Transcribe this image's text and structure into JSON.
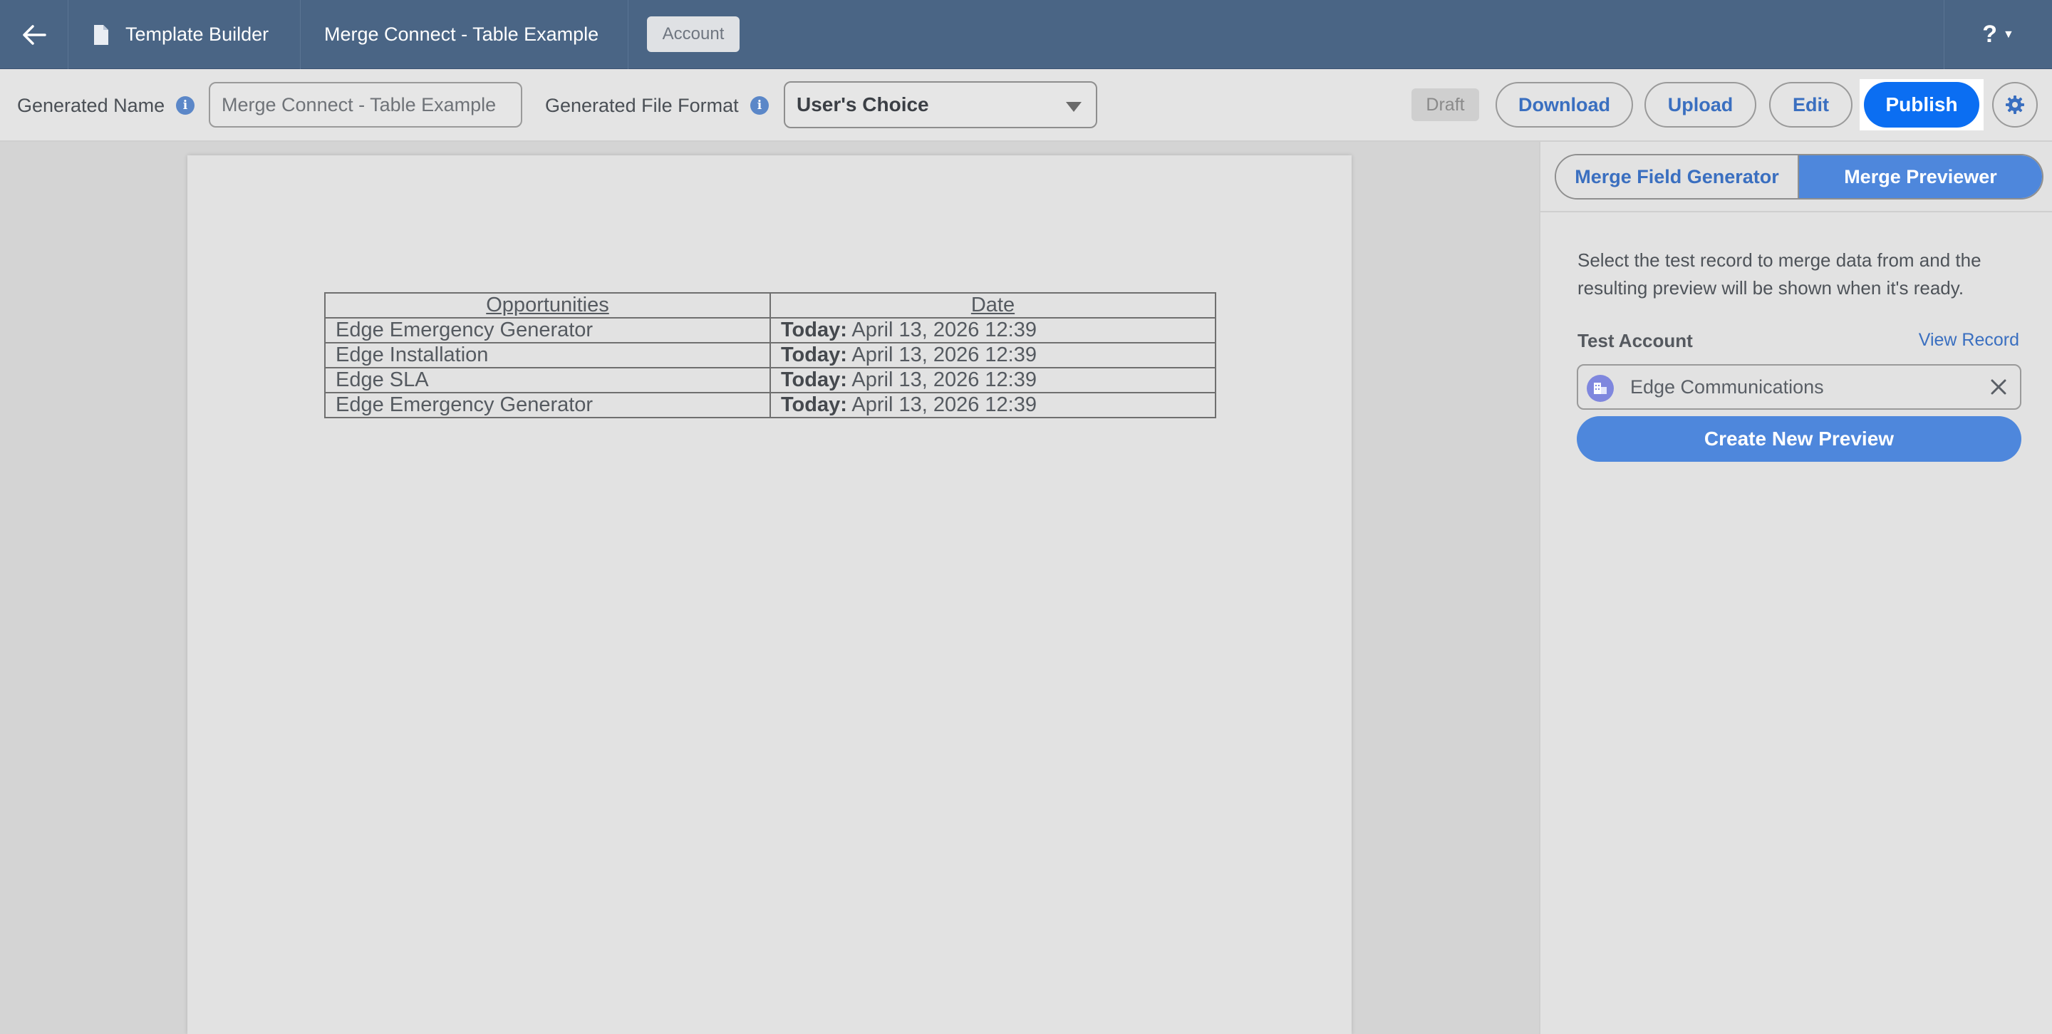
{
  "header": {
    "back_icon": "arrow-left-icon",
    "doc_icon": "document-icon",
    "template_builder": "Template Builder",
    "template_name": "Merge Connect - Table Example",
    "object_badge": "Account",
    "help_label": "?",
    "help_icon": "caret-down-icon"
  },
  "toolbar": {
    "generated_name_label": "Generated Name",
    "generated_name_value": "Merge Connect - Table Example",
    "file_format_label": "Generated File Format",
    "file_format_value": "User's Choice",
    "status": "Draft",
    "download": "Download",
    "upload": "Upload",
    "edit": "Edit",
    "publish": "Publish",
    "settings_icon": "gear-icon"
  },
  "document": {
    "table": {
      "headers": [
        "Opportunities",
        "Date"
      ],
      "rows": [
        {
          "opportunity": "Edge Emergency Generator",
          "date_prefix": "Today:",
          "date": "April 13, 2026 12:39"
        },
        {
          "opportunity": "Edge Installation",
          "date_prefix": "Today:",
          "date": "April 13, 2026 12:39"
        },
        {
          "opportunity": "Edge SLA",
          "date_prefix": "Today:",
          "date": "April 13, 2026 12:39"
        },
        {
          "opportunity": "Edge Emergency Generator",
          "date_prefix": "Today:",
          "date": "April 13, 2026 12:39"
        }
      ]
    }
  },
  "panel": {
    "tabs": [
      {
        "label": "Merge Field Generator",
        "active": false
      },
      {
        "label": "Merge Previewer",
        "active": true
      }
    ],
    "description": "Select the test record to merge data from and the resulting preview will be shown when it's ready.",
    "test_account_label": "Test Account",
    "view_record": "View Record",
    "record_name": "Edge Communications",
    "record_icon": "account-icon",
    "clear_icon": "close-icon",
    "create_preview": "Create New Preview"
  },
  "colors": {
    "header_bg": "#4a6585",
    "primary": "#0b6ef2",
    "accent": "#4e87dc",
    "link": "#3a6fc0"
  }
}
